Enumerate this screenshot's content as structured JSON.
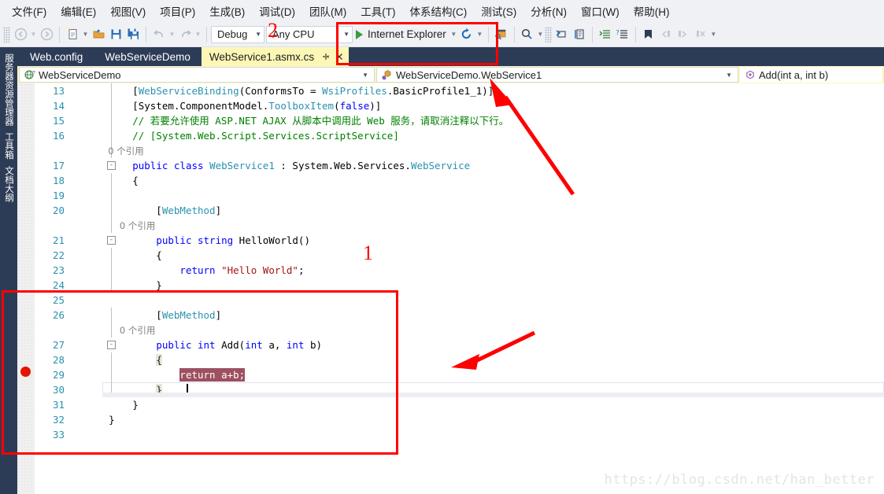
{
  "menu": {
    "items": [
      {
        "label": "文件(F)",
        "name": "menu-file"
      },
      {
        "label": "编辑(E)",
        "name": "menu-edit"
      },
      {
        "label": "视图(V)",
        "name": "menu-view"
      },
      {
        "label": "项目(P)",
        "name": "menu-project"
      },
      {
        "label": "生成(B)",
        "name": "menu-build"
      },
      {
        "label": "调试(D)",
        "name": "menu-debug"
      },
      {
        "label": "团队(M)",
        "name": "menu-team"
      },
      {
        "label": "工具(T)",
        "name": "menu-tools"
      },
      {
        "label": "体系结构(C)",
        "name": "menu-architecture"
      },
      {
        "label": "测试(S)",
        "name": "menu-test"
      },
      {
        "label": "分析(N)",
        "name": "menu-analyze"
      },
      {
        "label": "窗口(W)",
        "name": "menu-window"
      },
      {
        "label": "帮助(H)",
        "name": "menu-help"
      }
    ]
  },
  "toolbar": {
    "configuration": "Debug",
    "platform": "Any CPU",
    "run_target": "Internet Explorer",
    "icons": [
      "navigate-back-icon",
      "navigate-forward-icon",
      "new-file-icon",
      "open-file-icon",
      "save-icon",
      "save-all-icon",
      "undo-icon",
      "redo-icon",
      "start-debug-icon",
      "refresh-icon",
      "browser-icon",
      "find-icon",
      "comment-icon",
      "uncomment-icon",
      "indent-icon",
      "outdent-icon",
      "bookmark-icon",
      "prev-bookmark-icon",
      "next-bookmark-icon",
      "clear-bookmarks-icon"
    ]
  },
  "tabs": [
    {
      "label": "Web.config",
      "active": false
    },
    {
      "label": "WebServiceDemo",
      "active": false
    },
    {
      "label": "WebService1.asmx.cs",
      "active": true
    }
  ],
  "navbar": {
    "project": "WebServiceDemo",
    "type": "WebServiceDemo.WebService1",
    "member": "Add(int a, int b)"
  },
  "left_dock": {
    "tabs": [
      "服务器资源管理器",
      "工具箱",
      "文档大纲"
    ]
  },
  "editor": {
    "lines": [
      {
        "num": "13",
        "indent": 0,
        "fold": false,
        "vline": true,
        "tokens": [
          {
            "t": "        ",
            "c": "pln"
          },
          {
            "t": "[",
            "c": "pln"
          },
          {
            "t": "WebServiceBinding",
            "c": "typ"
          },
          {
            "t": "(ConformsTo = ",
            "c": "pln"
          },
          {
            "t": "WsiProfiles",
            "c": "typ"
          },
          {
            "t": ".BasicProfile1_1)]",
            "c": "pln"
          }
        ]
      },
      {
        "num": "14",
        "indent": 0,
        "fold": false,
        "vline": true,
        "tokens": [
          {
            "t": "        [System.ComponentModel.",
            "c": "pln"
          },
          {
            "t": "ToolboxItem",
            "c": "typ"
          },
          {
            "t": "(",
            "c": "pln"
          },
          {
            "t": "false",
            "c": "kw"
          },
          {
            "t": ")]",
            "c": "pln"
          }
        ]
      },
      {
        "num": "15",
        "indent": 0,
        "fold": false,
        "vline": true,
        "tokens": [
          {
            "t": "        // 若要允许使用 ASP.NET AJAX 从脚本中调用此 Web 服务，请取消注释以下行。",
            "c": "cmt"
          }
        ]
      },
      {
        "num": "16",
        "indent": 0,
        "fold": false,
        "vline": true,
        "tokens": [
          {
            "t": "        // [System.Web.Script.Services.ScriptService]",
            "c": "cmt"
          }
        ]
      },
      {
        "num": "",
        "indent": 0,
        "fold": false,
        "vline": true,
        "tokens": [
          {
            "t": "        0 个引用",
            "c": "ref"
          }
        ]
      },
      {
        "num": "17",
        "indent": 0,
        "fold": true,
        "vline": false,
        "tokens": [
          {
            "t": "        ",
            "c": "pln"
          },
          {
            "t": "public class ",
            "c": "kw"
          },
          {
            "t": "WebService1",
            "c": "typ"
          },
          {
            "t": " : System.Web.Services.",
            "c": "pln"
          },
          {
            "t": "WebService",
            "c": "typ"
          }
        ]
      },
      {
        "num": "18",
        "indent": 0,
        "fold": false,
        "vline": true,
        "tokens": [
          {
            "t": "        {",
            "c": "pln"
          }
        ]
      },
      {
        "num": "19",
        "indent": 0,
        "fold": false,
        "vline": true,
        "tokens": []
      },
      {
        "num": "20",
        "indent": 0,
        "fold": false,
        "vline": true,
        "tokens": [
          {
            "t": "            [",
            "c": "pln"
          },
          {
            "t": "WebMethod",
            "c": "typ"
          },
          {
            "t": "]",
            "c": "pln"
          }
        ]
      },
      {
        "num": "",
        "indent": 0,
        "fold": false,
        "vline": true,
        "tokens": [
          {
            "t": "            0 个引用",
            "c": "ref"
          }
        ]
      },
      {
        "num": "21",
        "indent": 0,
        "fold": true,
        "vline": false,
        "tokens": [
          {
            "t": "            ",
            "c": "pln"
          },
          {
            "t": "public string ",
            "c": "kw"
          },
          {
            "t": "HelloWorld()",
            "c": "pln"
          }
        ]
      },
      {
        "num": "22",
        "indent": 0,
        "fold": false,
        "vline": true,
        "tokens": [
          {
            "t": "            {",
            "c": "pln"
          }
        ]
      },
      {
        "num": "23",
        "indent": 0,
        "fold": false,
        "vline": true,
        "tokens": [
          {
            "t": "                ",
            "c": "pln"
          },
          {
            "t": "return ",
            "c": "kw"
          },
          {
            "t": "\"Hello World\"",
            "c": "str"
          },
          {
            "t": ";",
            "c": "pln"
          }
        ]
      },
      {
        "num": "24",
        "indent": 0,
        "fold": false,
        "vline": true,
        "tokens": [
          {
            "t": "            }",
            "c": "pln"
          }
        ]
      },
      {
        "num": "25",
        "indent": 0,
        "fold": false,
        "vline": false,
        "tokens": []
      },
      {
        "num": "26",
        "indent": 0,
        "fold": false,
        "vline": true,
        "tokens": [
          {
            "t": "            [",
            "c": "pln"
          },
          {
            "t": "WebMethod",
            "c": "typ"
          },
          {
            "t": "]",
            "c": "pln"
          }
        ]
      },
      {
        "num": "",
        "indent": 0,
        "fold": false,
        "vline": true,
        "tokens": [
          {
            "t": "            0 个引用",
            "c": "ref"
          }
        ]
      },
      {
        "num": "27",
        "indent": 0,
        "fold": true,
        "vline": false,
        "tokens": [
          {
            "t": "            ",
            "c": "pln"
          },
          {
            "t": "public int ",
            "c": "kw"
          },
          {
            "t": "Add(",
            "c": "pln"
          },
          {
            "t": "int",
            "c": "kw"
          },
          {
            "t": " a, ",
            "c": "pln"
          },
          {
            "t": "int",
            "c": "kw"
          },
          {
            "t": " b)",
            "c": "pln"
          }
        ]
      },
      {
        "num": "28",
        "indent": 0,
        "fold": false,
        "vline": true,
        "tokens": [
          {
            "t": "            ",
            "c": "pln"
          },
          {
            "t": "{",
            "c": "brace-hl"
          }
        ]
      },
      {
        "num": "29",
        "indent": 0,
        "fold": false,
        "vline": true,
        "tokens": [
          {
            "t": "                ",
            "c": "pln"
          },
          {
            "t": "return a+b;",
            "c": "sel-hl"
          }
        ]
      },
      {
        "num": "30",
        "indent": 0,
        "fold": false,
        "vline": true,
        "current": true,
        "tokens": [
          {
            "t": "            ",
            "c": "pln"
          },
          {
            "t": "}",
            "c": "brace-hl"
          }
        ]
      },
      {
        "num": "31",
        "indent": 0,
        "fold": false,
        "vline": false,
        "tokens": [
          {
            "t": "        }",
            "c": "pln"
          }
        ]
      },
      {
        "num": "32",
        "indent": 0,
        "fold": false,
        "vline": false,
        "tokens": [
          {
            "t": "    }",
            "c": "pln"
          }
        ]
      },
      {
        "num": "33",
        "indent": 0,
        "fold": false,
        "vline": false,
        "tokens": []
      }
    ],
    "breakpoint_line": "29"
  },
  "annotations": {
    "label_1": "1",
    "label_2": "2",
    "accent_color": "#ff0000"
  },
  "watermark": "https://blog.csdn.net/han_better"
}
